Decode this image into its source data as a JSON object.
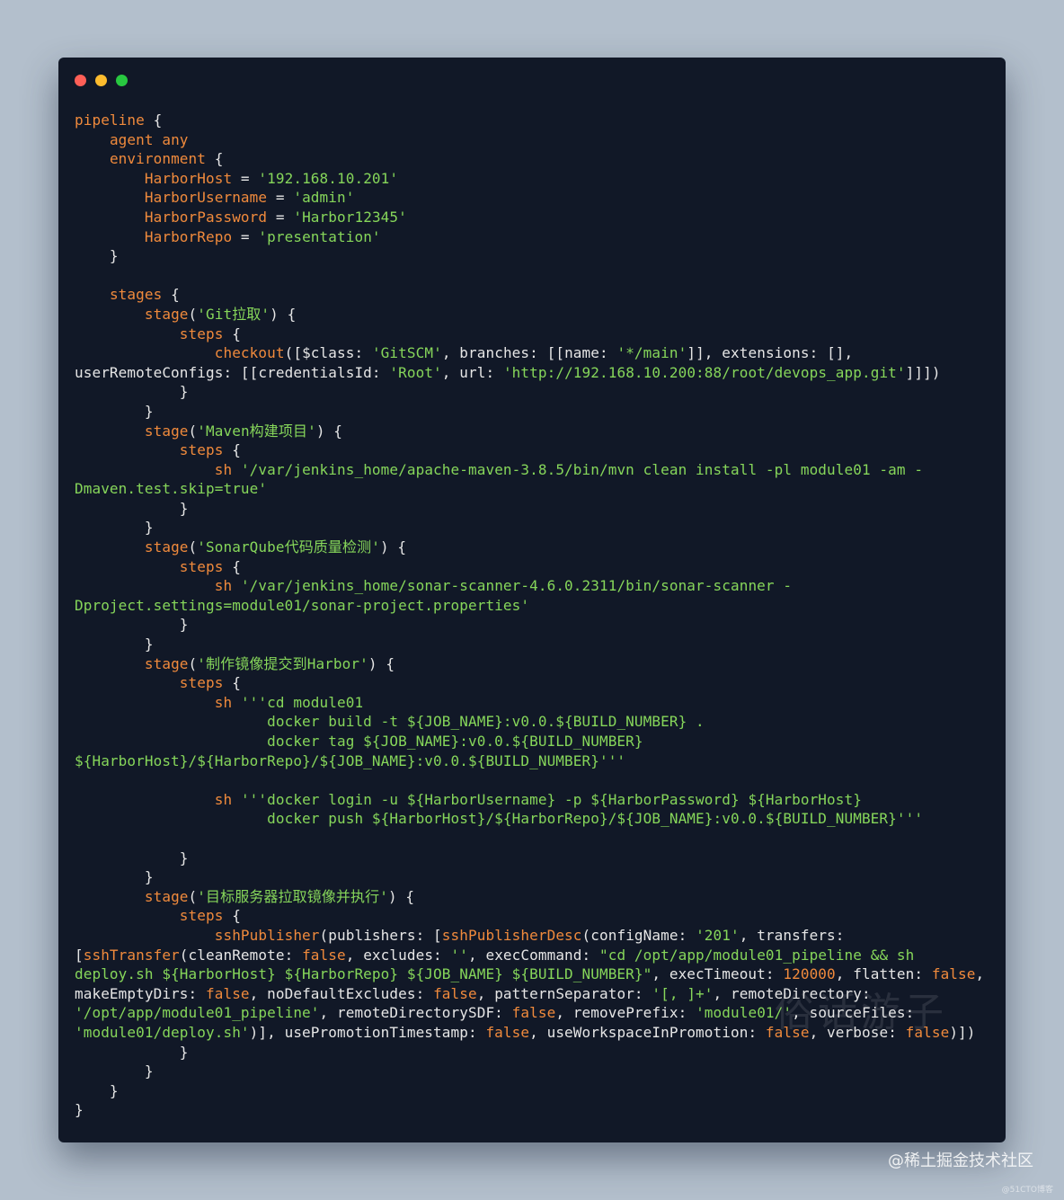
{
  "window": {
    "controls": [
      {
        "name": "close",
        "color": "#ff5f57"
      },
      {
        "name": "minimize",
        "color": "#febc2e"
      },
      {
        "name": "maximize",
        "color": "#28c840"
      }
    ]
  },
  "code": {
    "lines": [
      [
        [
          "k",
          "pipeline"
        ],
        [
          "p",
          " {"
        ]
      ],
      [
        [
          "p",
          "    "
        ],
        [
          "k",
          "agent any"
        ]
      ],
      [
        [
          "p",
          "    "
        ],
        [
          "k",
          "environment"
        ],
        [
          "p",
          " {"
        ]
      ],
      [
        [
          "p",
          "        "
        ],
        [
          "k",
          "HarborHost"
        ],
        [
          "p",
          " = "
        ],
        [
          "s",
          "'192.168.10.201'"
        ]
      ],
      [
        [
          "p",
          "        "
        ],
        [
          "k",
          "HarborUsername"
        ],
        [
          "p",
          " = "
        ],
        [
          "s",
          "'admin'"
        ]
      ],
      [
        [
          "p",
          "        "
        ],
        [
          "k",
          "HarborPassword"
        ],
        [
          "p",
          " = "
        ],
        [
          "s",
          "'Harbor12345'"
        ]
      ],
      [
        [
          "p",
          "        "
        ],
        [
          "k",
          "HarborRepo"
        ],
        [
          "p",
          " = "
        ],
        [
          "s",
          "'presentation'"
        ]
      ],
      [
        [
          "p",
          "    }"
        ]
      ],
      [
        [
          "p",
          ""
        ]
      ],
      [
        [
          "p",
          "    "
        ],
        [
          "k",
          "stages"
        ],
        [
          "p",
          " {"
        ]
      ],
      [
        [
          "p",
          "        "
        ],
        [
          "k",
          "stage"
        ],
        [
          "p",
          "("
        ],
        [
          "s",
          "'Git拉取'"
        ],
        [
          "p",
          ") {"
        ]
      ],
      [
        [
          "p",
          "            "
        ],
        [
          "k",
          "steps"
        ],
        [
          "p",
          " {"
        ]
      ],
      [
        [
          "p",
          "                "
        ],
        [
          "k",
          "checkout"
        ],
        [
          "p",
          "([$class: "
        ],
        [
          "s",
          "'GitSCM'"
        ],
        [
          "p",
          ", branches: [[name: "
        ],
        [
          "s",
          "'*/main'"
        ],
        [
          "p",
          "]], extensions: [],"
        ]
      ],
      [
        [
          "p",
          "userRemoteConfigs: [[credentialsId: "
        ],
        [
          "s",
          "'Root'"
        ],
        [
          "p",
          ", url: "
        ],
        [
          "s",
          "'http://192.168.10.200:88/root/devops_app.git'"
        ],
        [
          "p",
          "]]])"
        ]
      ],
      [
        [
          "p",
          "            }"
        ]
      ],
      [
        [
          "p",
          "        }"
        ]
      ],
      [
        [
          "p",
          "        "
        ],
        [
          "k",
          "stage"
        ],
        [
          "p",
          "("
        ],
        [
          "s",
          "'Maven构建项目'"
        ],
        [
          "p",
          ") {"
        ]
      ],
      [
        [
          "p",
          "            "
        ],
        [
          "k",
          "steps"
        ],
        [
          "p",
          " {"
        ]
      ],
      [
        [
          "p",
          "                "
        ],
        [
          "k",
          "sh"
        ],
        [
          "p",
          " "
        ],
        [
          "s",
          "'/var/jenkins_home/apache-maven-3.8.5/bin/mvn clean install -pl module01 -am -"
        ]
      ],
      [
        [
          "s",
          "Dmaven.test.skip=true'"
        ]
      ],
      [
        [
          "p",
          "            }"
        ]
      ],
      [
        [
          "p",
          "        }"
        ]
      ],
      [
        [
          "p",
          "        "
        ],
        [
          "k",
          "stage"
        ],
        [
          "p",
          "("
        ],
        [
          "s",
          "'SonarQube代码质量检测'"
        ],
        [
          "p",
          ") {"
        ]
      ],
      [
        [
          "p",
          "            "
        ],
        [
          "k",
          "steps"
        ],
        [
          "p",
          " {"
        ]
      ],
      [
        [
          "p",
          "                "
        ],
        [
          "k",
          "sh"
        ],
        [
          "p",
          " "
        ],
        [
          "s",
          "'/var/jenkins_home/sonar-scanner-4.6.0.2311/bin/sonar-scanner -"
        ]
      ],
      [
        [
          "s",
          "Dproject.settings=module01/sonar-project.properties'"
        ]
      ],
      [
        [
          "p",
          "            }"
        ]
      ],
      [
        [
          "p",
          "        }"
        ]
      ],
      [
        [
          "p",
          "        "
        ],
        [
          "k",
          "stage"
        ],
        [
          "p",
          "("
        ],
        [
          "s",
          "'制作镜像提交到Harbor'"
        ],
        [
          "p",
          ") {"
        ]
      ],
      [
        [
          "p",
          "            "
        ],
        [
          "k",
          "steps"
        ],
        [
          "p",
          " {"
        ]
      ],
      [
        [
          "p",
          "                "
        ],
        [
          "k",
          "sh"
        ],
        [
          "p",
          " "
        ],
        [
          "s",
          "'''cd module01"
        ]
      ],
      [
        [
          "s",
          "                      docker build -t ${JOB_NAME}:v0.0.${BUILD_NUMBER} ."
        ]
      ],
      [
        [
          "s",
          "                      docker tag ${JOB_NAME}:v0.0.${BUILD_NUMBER}"
        ]
      ],
      [
        [
          "s",
          "${HarborHost}/${HarborRepo}/${JOB_NAME}:v0.0.${BUILD_NUMBER}'''"
        ]
      ],
      [
        [
          "p",
          ""
        ]
      ],
      [
        [
          "p",
          "                "
        ],
        [
          "k",
          "sh"
        ],
        [
          "p",
          " "
        ],
        [
          "s",
          "'''docker login -u ${HarborUsername} -p ${HarborPassword} ${HarborHost}"
        ]
      ],
      [
        [
          "s",
          "                      docker push ${HarborHost}/${HarborRepo}/${JOB_NAME}:v0.0.${BUILD_NUMBER}'''"
        ]
      ],
      [
        [
          "p",
          ""
        ]
      ],
      [
        [
          "p",
          "            }"
        ]
      ],
      [
        [
          "p",
          "        }"
        ]
      ],
      [
        [
          "p",
          "        "
        ],
        [
          "k",
          "stage"
        ],
        [
          "p",
          "("
        ],
        [
          "s",
          "'目标服务器拉取镜像并执行'"
        ],
        [
          "p",
          ") {"
        ]
      ],
      [
        [
          "p",
          "            "
        ],
        [
          "k",
          "steps"
        ],
        [
          "p",
          " {"
        ]
      ],
      [
        [
          "p",
          "                "
        ],
        [
          "k",
          "sshPublisher"
        ],
        [
          "p",
          "(publishers: ["
        ],
        [
          "k",
          "sshPublisherDesc"
        ],
        [
          "p",
          "(configName: "
        ],
        [
          "s",
          "'201'"
        ],
        [
          "p",
          ", transfers:"
        ]
      ],
      [
        [
          "p",
          "["
        ],
        [
          "k",
          "sshTransfer"
        ],
        [
          "p",
          "(cleanRemote: "
        ],
        [
          "k",
          "false"
        ],
        [
          "p",
          ", excludes: "
        ],
        [
          "s",
          "''"
        ],
        [
          "p",
          ", execCommand: "
        ],
        [
          "s",
          "\"cd /opt/app/module01_pipeline && sh"
        ]
      ],
      [
        [
          "s",
          "deploy.sh ${HarborHost} ${HarborRepo} ${JOB_NAME} ${BUILD_NUMBER}\""
        ],
        [
          "p",
          ", execTimeout: "
        ],
        [
          "k",
          "120000"
        ],
        [
          "p",
          ", flatten: "
        ],
        [
          "k",
          "false"
        ],
        [
          "p",
          ","
        ]
      ],
      [
        [
          "p",
          "makeEmptyDirs: "
        ],
        [
          "k",
          "false"
        ],
        [
          "p",
          ", noDefaultExcludes: "
        ],
        [
          "k",
          "false"
        ],
        [
          "p",
          ", patternSeparator: "
        ],
        [
          "s",
          "'[, ]+'"
        ],
        [
          "p",
          ", remoteDirectory:"
        ]
      ],
      [
        [
          "s",
          "'/opt/app/module01_pipeline'"
        ],
        [
          "p",
          ", remoteDirectorySDF: "
        ],
        [
          "k",
          "false"
        ],
        [
          "p",
          ", removePrefix: "
        ],
        [
          "s",
          "'module01/'"
        ],
        [
          "p",
          ", sourceFiles:"
        ]
      ],
      [
        [
          "s",
          "'module01/deploy.sh'"
        ],
        [
          "p",
          ")], usePromotionTimestamp: "
        ],
        [
          "k",
          "false"
        ],
        [
          "p",
          ", useWorkspaceInPromotion: "
        ],
        [
          "k",
          "false"
        ],
        [
          "p",
          ", verbose: "
        ],
        [
          "k",
          "false"
        ],
        [
          "p",
          ")])"
        ]
      ],
      [
        [
          "p",
          "            }"
        ]
      ],
      [
        [
          "p",
          "        }"
        ]
      ],
      [
        [
          "p",
          "    }"
        ]
      ],
      [
        [
          "p",
          "}"
        ]
      ]
    ]
  },
  "watermark": "@稀土掘金技术社区",
  "faint_watermark": "俗话游子",
  "tiny_watermark": "@51CTO博客"
}
